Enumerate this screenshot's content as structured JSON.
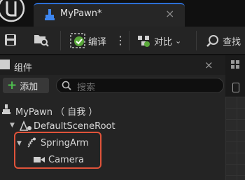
{
  "window": {
    "tab_title": "MyPawn*",
    "tab_close": "×"
  },
  "toolbar": {
    "compile_label": "编译",
    "more_label": "⋮",
    "diff_label": "对比",
    "find_label": "查找"
  },
  "components_panel": {
    "title": "组件",
    "close": "×",
    "add_label": "添加",
    "search_placeholder": "搜索"
  },
  "tree": {
    "root": "MyPawn （ 自我 ）",
    "items": [
      {
        "label": "DefaultSceneRoot"
      },
      {
        "label": "SpringArm"
      },
      {
        "label": "Camera"
      }
    ]
  },
  "colors": {
    "accent_blue": "#2d6fd6",
    "highlight_red": "#e0533a",
    "add_green": "#4fc04f"
  }
}
